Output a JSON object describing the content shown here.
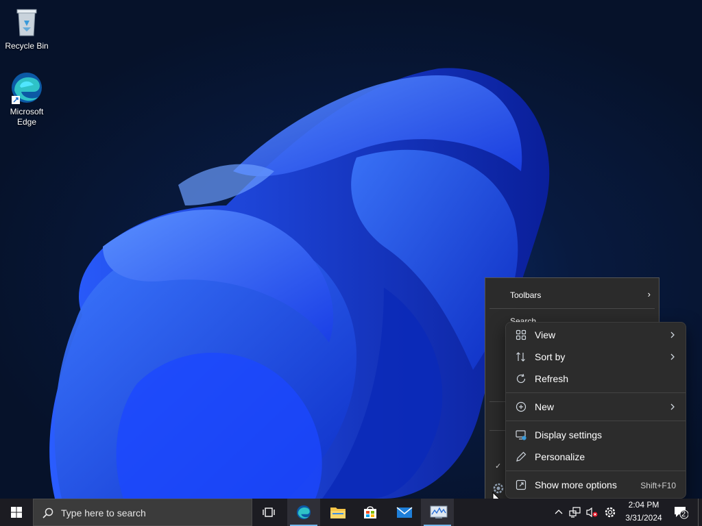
{
  "desktop": {
    "icons": [
      {
        "label": "Recycle Bin",
        "icon": "recycle-bin-icon"
      },
      {
        "label": "Microsoft\nEdge",
        "icon": "edge-icon"
      }
    ]
  },
  "taskbar_menu": {
    "items": [
      {
        "label": "Toolbars",
        "has_submenu": true
      },
      {
        "label": "Search"
      }
    ]
  },
  "context_menu": {
    "items": [
      {
        "label": "View",
        "icon": "grid-icon",
        "has_submenu": true
      },
      {
        "label": "Sort by",
        "icon": "sort-icon",
        "has_submenu": true
      },
      {
        "label": "Refresh",
        "icon": "refresh-icon"
      },
      {
        "label": "New",
        "icon": "new-plus-icon",
        "has_submenu": true
      },
      {
        "label": "Display settings",
        "icon": "display-settings-icon"
      },
      {
        "label": "Personalize",
        "icon": "pen-icon"
      },
      {
        "label": "Show more options",
        "icon": "open-external-icon",
        "shortcut": "Shift+F10"
      }
    ]
  },
  "taskbar": {
    "search_placeholder": "Type here to search",
    "apps": [
      "task-view-icon",
      "edge-icon",
      "file-explorer-icon",
      "store-icon",
      "mail-icon",
      "performance-monitor-icon"
    ],
    "time": "2:04 PM",
    "date": "3/31/2024",
    "notification_count": "2"
  },
  "colors": {
    "accent": "#76b9ed",
    "menu_bg": "#2c2c2c",
    "taskbar_bg": "#1c1c22"
  }
}
